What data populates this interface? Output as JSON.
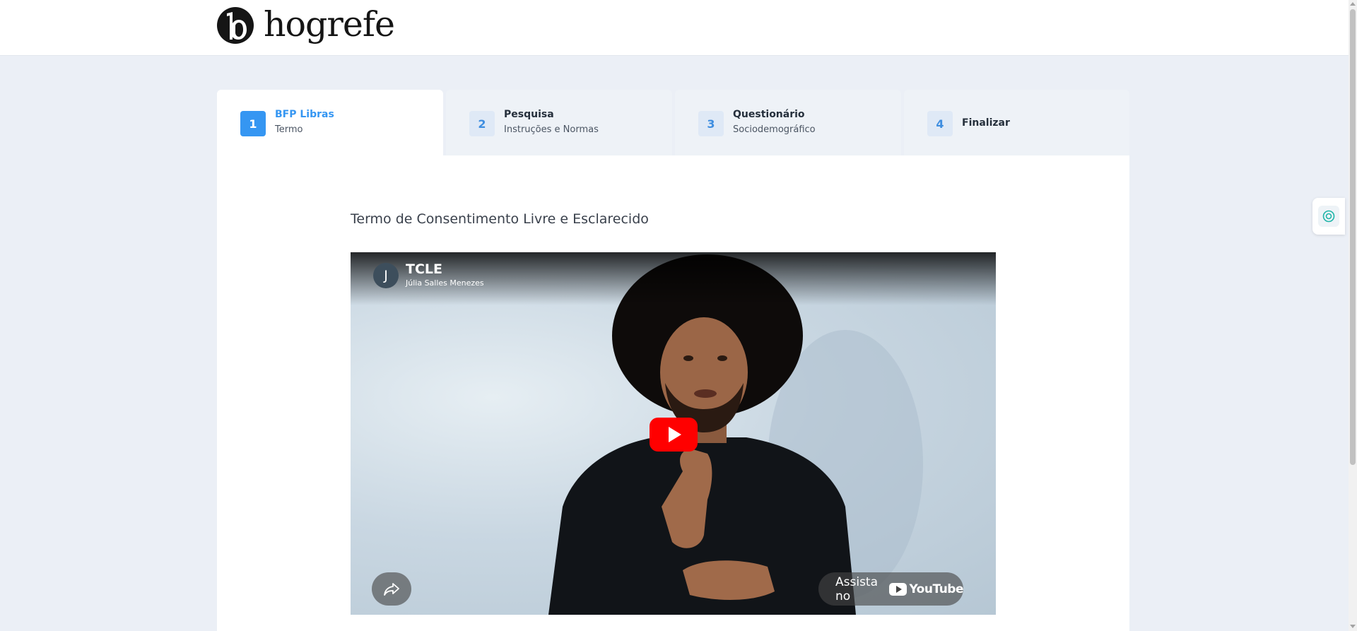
{
  "brand": {
    "name": "hogrefe",
    "logo_icon": "hogrefe-logo-icon"
  },
  "steps": [
    {
      "number": "1",
      "title": "BFP Libras",
      "subtitle": "Termo",
      "state": "active"
    },
    {
      "number": "2",
      "title": "Pesquisa",
      "subtitle": "Instruções e Normas",
      "state": "inactive"
    },
    {
      "number": "3",
      "title": "Questionário",
      "subtitle": "Sociodemográfico",
      "state": "inactive"
    },
    {
      "number": "4",
      "title": "Finalizar",
      "subtitle": "",
      "state": "inactive"
    }
  ],
  "main": {
    "heading": "Termo de Consentimento Livre e Esclarecido"
  },
  "video": {
    "title": "TCLE",
    "channel": "Júlia Salles Menezes",
    "channel_initial": "J",
    "watch_label": "Assista no",
    "youtube_word": "YouTube",
    "icons": {
      "play": "play-icon",
      "share": "share-icon",
      "youtube": "youtube-logo-icon"
    }
  },
  "colors": {
    "accent": "#3596f2",
    "page_bg": "#ebeff6",
    "tab_inactive": "#eef2f7",
    "youtube_red": "#ff0000",
    "accessibility_teal": "#1fb5a8"
  },
  "accessibility": {
    "icon": "accessibility-icon"
  }
}
